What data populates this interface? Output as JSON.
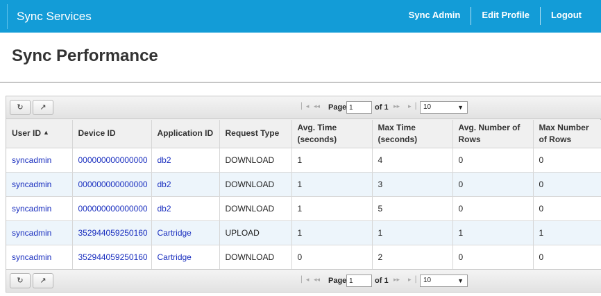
{
  "nav": {
    "brand": "Sync Services",
    "links": [
      "Sync Admin",
      "Edit Profile",
      "Logout"
    ],
    "color": "#139cd7"
  },
  "page": {
    "title": "Sync Performance"
  },
  "toolbar": {
    "refresh_icon": "refresh-icon",
    "export_icon": "external-link-icon"
  },
  "pager": {
    "page_label": "Page",
    "page_value": "1",
    "of_label": "of 1",
    "page_size": "10"
  },
  "table": {
    "columns": [
      "User ID",
      "Device ID",
      "Application ID",
      "Request Type",
      "Avg. Time (seconds)",
      "Max Time (seconds)",
      "Avg. Number of Rows",
      "Max Number of Rows"
    ],
    "sorted_column": "User ID",
    "rows": [
      [
        "syncadmin",
        "000000000000000",
        "db2",
        "DOWNLOAD",
        "1",
        "4",
        "0",
        "0"
      ],
      [
        "syncadmin",
        "000000000000000",
        "db2",
        "DOWNLOAD",
        "1",
        "3",
        "0",
        "0"
      ],
      [
        "syncadmin",
        "000000000000000",
        "db2",
        "DOWNLOAD",
        "1",
        "5",
        "0",
        "0"
      ],
      [
        "syncadmin",
        "352944059250160",
        "Cartridge",
        "UPLOAD",
        "1",
        "1",
        "1",
        "1"
      ],
      [
        "syncadmin",
        "352944059250160",
        "Cartridge",
        "DOWNLOAD",
        "0",
        "2",
        "0",
        "0"
      ]
    ]
  }
}
